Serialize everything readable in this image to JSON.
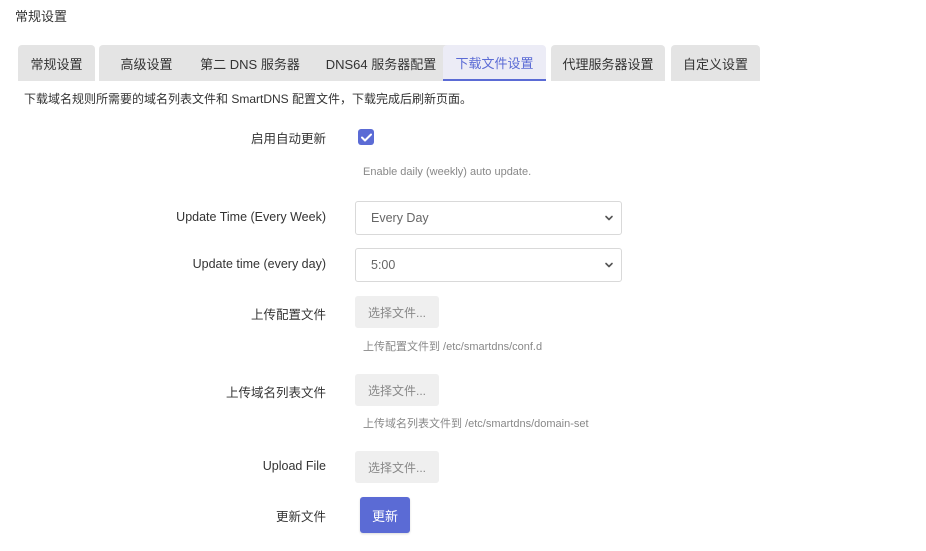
{
  "page": {
    "section_title": "常规设置"
  },
  "tabs": [
    {
      "label": "常规设置",
      "active": false
    },
    {
      "label": "高级设置",
      "active": false
    },
    {
      "label": "第二 DNS 服务器",
      "active": false
    },
    {
      "label": "DNS64 服务器配置",
      "active": false
    },
    {
      "label": "下载文件设置",
      "active": true
    },
    {
      "label": "代理服务器设置",
      "active": false
    },
    {
      "label": "自定义设置",
      "active": false
    }
  ],
  "description": "下载域名规则所需要的域名列表文件和 SmartDNS 配置文件，下载完成后刷新页面。",
  "form": {
    "auto_update": {
      "label": "启用自动更新",
      "checked": true,
      "hint": "Enable daily (weekly) auto update."
    },
    "update_time_week": {
      "label": "Update Time (Every Week)",
      "value": "Every Day"
    },
    "update_time_day": {
      "label": "Update time (every day)",
      "value": "5:00"
    },
    "upload_config": {
      "label": "上传配置文件",
      "button": "选择文件...",
      "hint": "上传配置文件到 /etc/smartdns/conf.d"
    },
    "upload_domain_list": {
      "label": "上传域名列表文件",
      "button": "选择文件...",
      "hint": "上传域名列表文件到 /etc/smartdns/domain-set"
    },
    "upload_file": {
      "label": "Upload File",
      "button": "选择文件..."
    },
    "update_files": {
      "label": "更新文件",
      "button": "更新"
    }
  },
  "colors": {
    "accent": "#5b6bd5",
    "tab_bg": "#e4e4e4",
    "active_tab_bg": "#ececf6"
  },
  "icons": {
    "checkbox": "check-icon",
    "select": "chevron-down-icon"
  }
}
